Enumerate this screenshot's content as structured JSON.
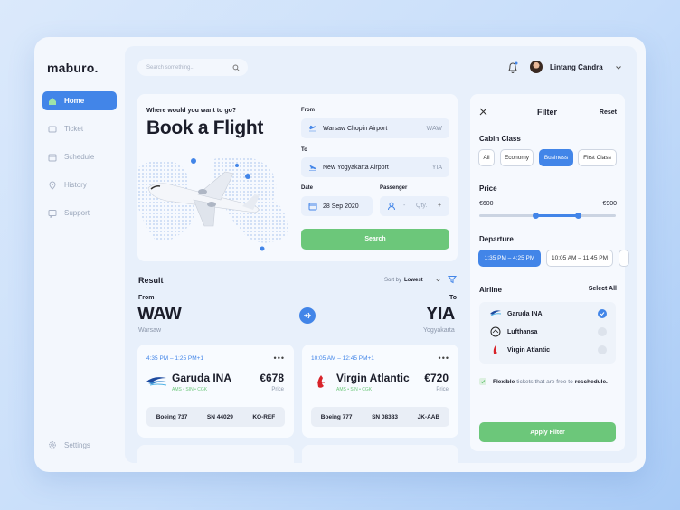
{
  "app": {
    "logo": "maburo."
  },
  "nav": {
    "items": [
      {
        "label": "Home"
      },
      {
        "label": "Ticket"
      },
      {
        "label": "Schedule"
      },
      {
        "label": "History"
      },
      {
        "label": "Support"
      }
    ],
    "settings": "Settings"
  },
  "header": {
    "search_placeholder": "Search something...",
    "user_name": "Lintang Candra"
  },
  "book": {
    "question": "Where would you want to go?",
    "title": "Book a Flight",
    "from_label": "From",
    "from_value": "Warsaw Chopin Airport",
    "from_code": "WAW",
    "to_label": "To",
    "to_value": "New Yogyakarta Airport",
    "to_code": "YIA",
    "date_label": "Date",
    "date_value": "28 Sep 2020",
    "passenger_label": "Passenger",
    "minus": "-",
    "qty_placeholder": "Qty.",
    "plus": "+",
    "search_button": "Search"
  },
  "result": {
    "title": "Result",
    "sort_label": "Sort by",
    "sort_value": "Lowest",
    "from_label": "From",
    "to_label": "To",
    "from_code": "WAW",
    "to_code": "YIA",
    "from_city": "Warsaw",
    "to_city": "Yogyakarta",
    "cards": [
      {
        "time": "4:35 PM – 1:25 PM+1",
        "airline": "Garuda INA",
        "route": "AMS • SIN • CGK",
        "price": "€678",
        "price_label": "Price",
        "aircraft": "Boeing 737",
        "flight_no": "SN 44029",
        "segment": "KO-REF"
      },
      {
        "time": "10:05 AM – 12:45 PM+1",
        "airline": "Virgin Atlantic",
        "route": "AMS • SIN • CGK",
        "price": "€720",
        "price_label": "Price",
        "aircraft": "Boeing 777",
        "flight_no": "SN 08383",
        "segment": "JK-AAB"
      }
    ]
  },
  "filter": {
    "title": "Filter",
    "reset": "Reset",
    "cabin_label": "Cabin Class",
    "cabin_options": [
      "All",
      "Economy",
      "Business",
      "First Class"
    ],
    "cabin_selected": "Business",
    "price_label": "Price",
    "price_min": "€600",
    "price_max": "€900",
    "departure_label": "Departure",
    "departure_options": [
      "1:35 PM – 4:25 PM",
      "10:05 AM – 11:45 PM"
    ],
    "airline_label": "Airline",
    "select_all": "Select All",
    "airlines": [
      {
        "name": "Garuda INA",
        "selected": true
      },
      {
        "name": "Lufthansa",
        "selected": false
      },
      {
        "name": "Virgin Atlantic",
        "selected": false
      }
    ],
    "flexible_pre": "Flexible",
    "flexible_mid": "tickets that are free to",
    "flexible_post": "reschedule.",
    "apply_button": "Apply Filter"
  },
  "colors": {
    "accent": "#4285e8",
    "success": "#6cc77a"
  }
}
